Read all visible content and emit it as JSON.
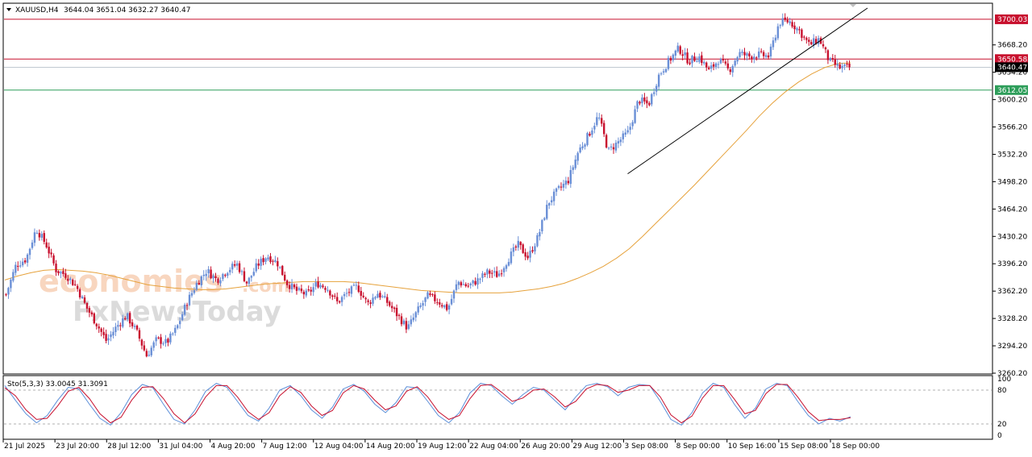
{
  "header": {
    "symbol": "XAUUSD,H4",
    "ohlc": "3644.04 3651.04 3632.27 3640.47"
  },
  "watermark": {
    "line1": "economies",
    "line2": ".com",
    "line3": "FxNewsToday"
  },
  "colors": {
    "bull": "#6a8fd6",
    "bear": "#c8102e",
    "ma": "#e6a23c",
    "resistance": "#c8102e",
    "support": "#2e9e5a",
    "trendline": "#000000",
    "stoch_main": "#5b8fd9",
    "stoch_signal": "#c8102e"
  },
  "chart_data": [
    {
      "type": "candlestick",
      "title": "XAUUSD,H4",
      "ylim": [
        3260.2,
        3719
      ],
      "y_ticks": [
        "3668.20",
        "3634.20",
        "3600.20",
        "3566.20",
        "3532.20",
        "3498.20",
        "3464.20",
        "3430.20",
        "3396.20",
        "3362.20",
        "3328.20",
        "3294.20",
        "3260.20"
      ],
      "x_ticks": [
        "21 Jul 2025",
        "23 Jul 20:00",
        "28 Jul 12:00",
        "31 Jul 04:00",
        "4 Aug 20:00",
        "7 Aug 12:00",
        "12 Aug 04:00",
        "14 Aug 20:00",
        "19 Aug 12:00",
        "22 Aug 04:00",
        "26 Aug 20:00",
        "29 Aug 12:00",
        "3 Sep 08:00",
        "8 Sep 00:00",
        "10 Sep 16:00",
        "15 Sep 08:00",
        "18 Sep 00:00"
      ],
      "price_path": [
        3358,
        3395,
        3402,
        3440,
        3420,
        3388,
        3382,
        3368,
        3342,
        3322,
        3300,
        3318,
        3332,
        3312,
        3282,
        3302,
        3298,
        3316,
        3348,
        3372,
        3388,
        3376,
        3388,
        3396,
        3372,
        3394,
        3406,
        3398,
        3372,
        3362,
        3358,
        3372,
        3366,
        3348,
        3360,
        3368,
        3346,
        3360,
        3348,
        3332,
        3316,
        3338,
        3356,
        3350,
        3340,
        3374,
        3368,
        3376,
        3386,
        3382,
        3402,
        3420,
        3404,
        3430,
        3472,
        3488,
        3500,
        3536,
        3556,
        3580,
        3536,
        3548,
        3560,
        3600,
        3594,
        3630,
        3648,
        3664,
        3648,
        3654,
        3636,
        3650,
        3636,
        3658,
        3654,
        3656,
        3654,
        3696,
        3698,
        3686,
        3668,
        3676,
        3648,
        3640,
        3640
      ],
      "moving_average": [
        3376,
        3381,
        3385,
        3388,
        3389,
        3388,
        3387,
        3385,
        3382,
        3378,
        3374,
        3370,
        3368,
        3366,
        3365,
        3364,
        3364,
        3365,
        3367,
        3369,
        3371,
        3372,
        3373,
        3374,
        3374,
        3374,
        3374,
        3373,
        3371,
        3369,
        3367,
        3365,
        3363,
        3362,
        3361,
        3360,
        3360,
        3360,
        3360,
        3361,
        3363,
        3365,
        3368,
        3372,
        3378,
        3385,
        3393,
        3403,
        3415,
        3430,
        3446,
        3462,
        3478,
        3494,
        3511,
        3528,
        3545,
        3562,
        3580,
        3596,
        3610,
        3622,
        3632,
        3640,
        3645,
        3646
      ],
      "horizontal_levels": [
        {
          "label": "3700.03",
          "value": 3700.03,
          "role": "resistance"
        },
        {
          "label": "3650.58",
          "value": 3650.58,
          "role": "resistance"
        },
        {
          "label": "3640.47",
          "value": 3640.47,
          "role": "current"
        },
        {
          "label": "3612.05",
          "value": 3612.05,
          "role": "support"
        }
      ],
      "trendline": {
        "from": [
          "3 Sep 08:00",
          3508
        ],
        "to": [
          "18 Sep",
          3714
        ]
      }
    },
    {
      "type": "line",
      "title": "Sto(5,3,3) 33.0045 31.3091",
      "ylim": [
        0,
        100
      ],
      "y_ticks": [
        "100",
        "80",
        "20",
        "0"
      ],
      "levels": [
        80,
        20
      ],
      "series": [
        {
          "name": "main",
          "values": [
            88,
            62,
            38,
            22,
            35,
            62,
            85,
            82,
            55,
            30,
            18,
            40,
            72,
            90,
            84,
            55,
            28,
            20,
            45,
            78,
            92,
            85,
            60,
            35,
            25,
            48,
            80,
            88,
            70,
            45,
            30,
            50,
            82,
            90,
            78,
            55,
            40,
            58,
            86,
            84,
            60,
            35,
            22,
            40,
            75,
            92,
            88,
            70,
            55,
            72,
            85,
            80,
            62,
            45,
            68,
            88,
            92,
            86,
            70,
            85,
            90,
            88,
            60,
            28,
            18,
            40,
            75,
            92,
            85,
            55,
            30,
            48,
            82,
            92,
            88,
            60,
            35,
            20,
            30,
            25,
            33
          ]
        },
        {
          "name": "signal",
          "values": [
            84,
            70,
            45,
            28,
            30,
            52,
            78,
            85,
            65,
            38,
            22,
            32,
            62,
            85,
            86,
            65,
            38,
            22,
            38,
            68,
            88,
            88,
            68,
            42,
            28,
            40,
            70,
            86,
            76,
            52,
            35,
            44,
            75,
            88,
            82,
            62,
            45,
            52,
            78,
            86,
            68,
            42,
            28,
            35,
            65,
            88,
            90,
            76,
            60,
            66,
            80,
            82,
            68,
            50,
            60,
            82,
            90,
            88,
            76,
            80,
            88,
            88,
            68,
            36,
            22,
            34,
            66,
            88,
            88,
            64,
            38,
            44,
            74,
            90,
            90,
            68,
            42,
            26,
            28,
            28,
            31
          ]
        }
      ]
    }
  ]
}
